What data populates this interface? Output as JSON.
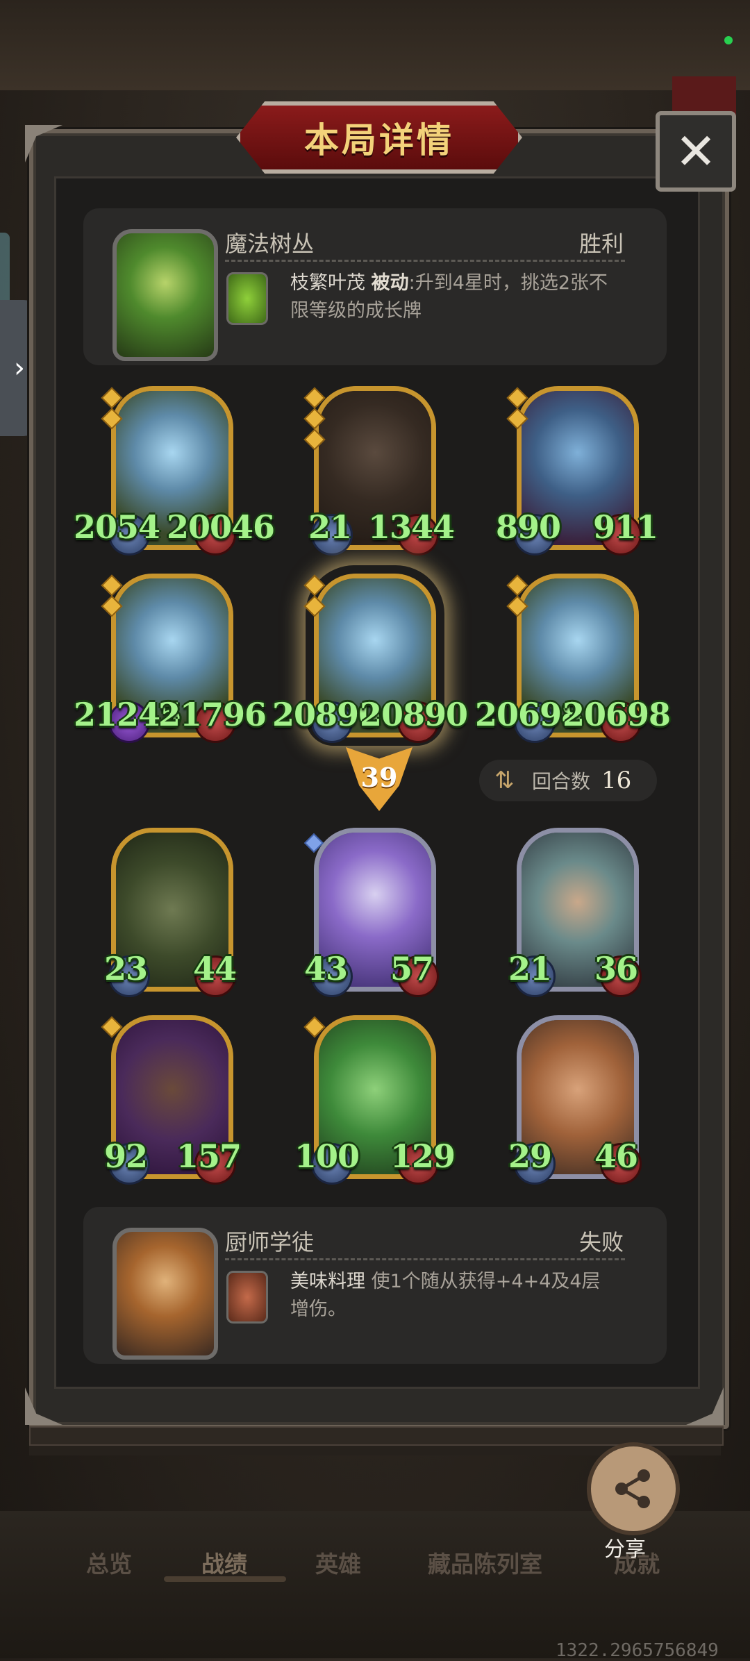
{
  "dialog": {
    "title": "本局详情",
    "close_label": "✕"
  },
  "top_hero": {
    "name": "魔法树丛",
    "result": "胜利",
    "skill_name": "枝繁叶茂",
    "skill_type": "被动",
    "skill_desc": ":升到4星时，挑选2张不限等级的成长牌"
  },
  "top_board": [
    {
      "atk": "2054",
      "hp": "20046"
    },
    {
      "atk": "21",
      "hp": "1344"
    },
    {
      "atk": "890",
      "hp": "911"
    },
    {
      "atk": "21245",
      "hp": "21796"
    },
    {
      "atk": "20890",
      "hp": "20890"
    },
    {
      "atk": "20698",
      "hp": "20698"
    }
  ],
  "level": "39",
  "turns": {
    "label": "回合数",
    "value": "16"
  },
  "bottom_board": [
    {
      "atk": "23",
      "hp": "44"
    },
    {
      "atk": "43",
      "hp": "57"
    },
    {
      "atk": "21",
      "hp": "36"
    },
    {
      "atk": "92",
      "hp": "157"
    },
    {
      "atk": "100",
      "hp": "129"
    },
    {
      "atk": "29",
      "hp": "46"
    }
  ],
  "bottom_hero": {
    "name": "厨师学徒",
    "result": "失败",
    "skill_name": "美味料理",
    "skill_desc": "使1个随从获得+4+4及4层增伤。"
  },
  "share": {
    "label": "分享"
  },
  "nav": [
    "总览",
    "战绩",
    "英雄",
    "藏品陈列室",
    "成就"
  ],
  "footer_id": "1322.2965756849",
  "colors": {
    "stat_green": "#a4f28a",
    "gold_frame": "#c7952e",
    "title_red": "#8b1b1b"
  }
}
